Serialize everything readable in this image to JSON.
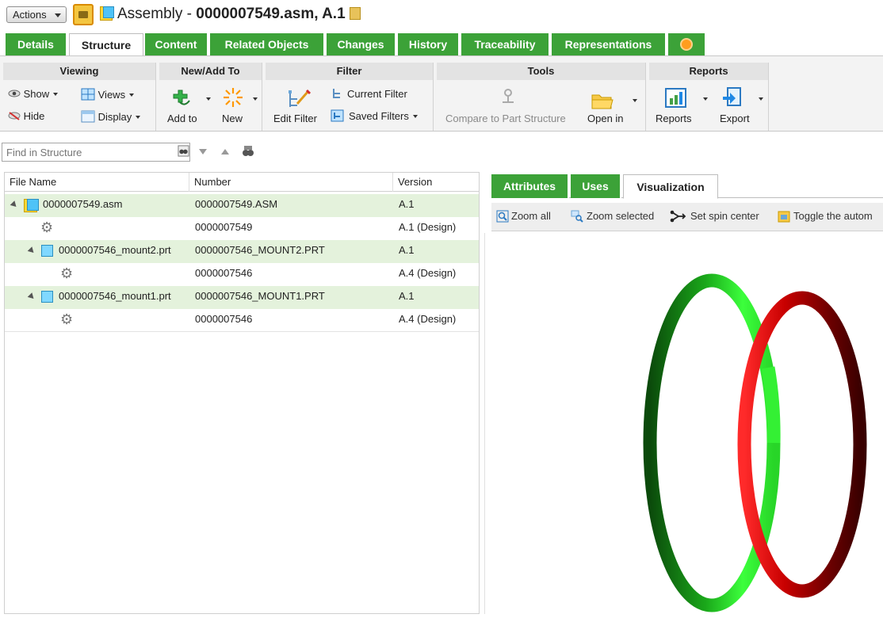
{
  "titlebar": {
    "actions_label": "Actions",
    "title_prefix": "Assembly - ",
    "title_bold": "0000007549.asm, A.1"
  },
  "tabs": [
    {
      "label": "Details",
      "active": false
    },
    {
      "label": "Structure",
      "active": true
    },
    {
      "label": "Content",
      "active": false
    },
    {
      "label": "Related Objects",
      "active": false
    },
    {
      "label": "Changes",
      "active": false
    },
    {
      "label": "History",
      "active": false
    },
    {
      "label": "Traceability",
      "active": false
    },
    {
      "label": "Representations",
      "active": false
    }
  ],
  "ribbon": {
    "viewing": {
      "title": "Viewing",
      "show": "Show",
      "hide": "Hide",
      "views": "Views",
      "display": "Display"
    },
    "new_add_to": {
      "title": "New/Add To",
      "add_to": "Add to",
      "new": "New"
    },
    "filter": {
      "title": "Filter",
      "edit_filter": "Edit Filter",
      "current_filter": "Current Filter",
      "saved_filters": "Saved Filters"
    },
    "tools": {
      "title": "Tools",
      "compare": "Compare to Part Structure",
      "open_in": "Open in"
    },
    "reports": {
      "title": "Reports",
      "reports": "Reports",
      "export": "Export"
    }
  },
  "find": {
    "placeholder": "Find in Structure"
  },
  "structure_table": {
    "columns": [
      "File Name",
      "Number",
      "Version"
    ],
    "rows": [
      {
        "name": "0000007549.asm",
        "number": "0000007549.ASM",
        "version": "A.1",
        "kind": "asm",
        "level": 0,
        "highlight": true
      },
      {
        "name": "",
        "number": "0000007549",
        "version": "A.1 (Design)",
        "kind": "gear",
        "level": 1,
        "highlight": false
      },
      {
        "name": "0000007546_mount2.prt",
        "number": "0000007546_MOUNT2.PRT",
        "version": "A.1",
        "kind": "prt",
        "level": 1,
        "highlight": true
      },
      {
        "name": "",
        "number": "0000007546",
        "version": "A.4 (Design)",
        "kind": "gear",
        "level": 2,
        "highlight": false
      },
      {
        "name": "0000007546_mount1.prt",
        "number": "0000007546_MOUNT1.PRT",
        "version": "A.1",
        "kind": "prt",
        "level": 1,
        "highlight": true
      },
      {
        "name": "",
        "number": "0000007546",
        "version": "A.4 (Design)",
        "kind": "gear",
        "level": 2,
        "highlight": false
      }
    ]
  },
  "right_tabs": [
    {
      "label": "Attributes",
      "active": false
    },
    {
      "label": "Uses",
      "active": false
    },
    {
      "label": "Visualization",
      "active": true
    }
  ],
  "vis_toolbar": {
    "zoom_all": "Zoom all",
    "zoom_selected": "Zoom selected",
    "set_spin_center": "Set spin center",
    "toggle": "Toggle the autom"
  },
  "colors": {
    "tab_green": "#3ca238",
    "row_highlight": "#e4f2dc",
    "ring_green": "#1fd01f",
    "ring_red": "#b00000"
  }
}
